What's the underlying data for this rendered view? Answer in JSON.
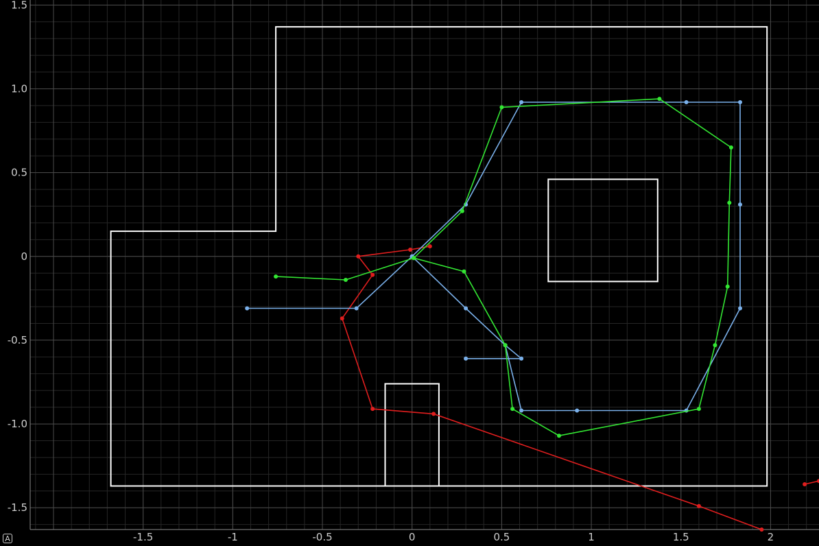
{
  "chart_data": {
    "type": "line",
    "title": "",
    "xlabel": "",
    "ylabel": "",
    "xlim": [
      -2.13,
      2.27
    ],
    "ylim": [
      -1.63,
      1.53
    ],
    "grid": true,
    "x_ticks": [
      -1.5,
      -1,
      -0.5,
      0,
      0.5,
      1,
      1.5,
      2
    ],
    "x_tick_labels": [
      "-1.5",
      "-1",
      "-0.5",
      "0",
      "0.5",
      "1",
      "1.5",
      "2"
    ],
    "y_ticks": [
      1.5,
      1.0,
      0.5,
      0,
      -0.5,
      -1.0,
      -1.5
    ],
    "y_tick_labels": [
      "1.5",
      "1.0",
      "0.5",
      "0",
      "-0.5",
      "-1.0",
      "-1.5"
    ],
    "obstacles": [
      {
        "name": "",
        "points": [
          [
            -0.76,
            1.37
          ],
          [
            1.98,
            1.37
          ],
          [
            1.98,
            -1.37
          ],
          [
            -1.68,
            -1.37
          ],
          [
            -1.68,
            0.15
          ],
          [
            -0.76,
            0.15
          ]
        ]
      },
      {
        "name": "",
        "points": [
          [
            0.76,
            0.46
          ],
          [
            1.37,
            0.46
          ],
          [
            1.37,
            -0.15
          ],
          [
            0.76,
            -0.15
          ]
        ]
      },
      {
        "name": "",
        "points": [
          [
            -0.15,
            -1.37
          ],
          [
            -0.15,
            -0.76
          ],
          [
            0.15,
            -0.76
          ],
          [
            0.15,
            -1.37
          ]
        ]
      }
    ],
    "series": [
      {
        "name": "",
        "color": "#e01e1e",
        "points": [
          [
            0.1,
            0.06
          ],
          [
            -0.01,
            0.04
          ],
          [
            -0.3,
            0.0
          ],
          [
            -0.22,
            -0.11
          ],
          [
            -0.39,
            -0.37
          ],
          [
            -0.22,
            -0.91
          ],
          [
            0.12,
            -0.94
          ],
          [
            1.6,
            -1.49
          ],
          [
            1.95,
            -1.63
          ]
        ]
      },
      {
        "name": "",
        "color": "#e01e1e",
        "points": [
          [
            2.19,
            -1.36
          ],
          [
            2.27,
            -1.34
          ]
        ]
      },
      {
        "name": "",
        "color": "#7ab0ea",
        "points": [
          [
            -0.92,
            -0.31
          ],
          [
            -0.31,
            -0.31
          ],
          [
            0.0,
            0.0
          ],
          [
            0.3,
            0.31
          ],
          [
            0.61,
            0.92
          ],
          [
            1.53,
            0.92
          ],
          [
            1.83,
            0.92
          ],
          [
            1.83,
            0.31
          ],
          [
            1.83,
            -0.31
          ],
          [
            1.53,
            -0.92
          ],
          [
            0.92,
            -0.92
          ],
          [
            0.61,
            -0.92
          ],
          [
            0.52,
            -0.53
          ],
          [
            0.3,
            -0.31
          ],
          [
            0.0,
            0.0
          ]
        ]
      },
      {
        "name": "",
        "color": "#7ab0ea",
        "points": [
          [
            0.3,
            -0.61
          ],
          [
            0.61,
            -0.61
          ],
          [
            0.52,
            -0.53
          ]
        ]
      },
      {
        "name": "",
        "color": "#33e633",
        "points": [
          [
            -0.76,
            -0.12
          ],
          [
            -0.37,
            -0.14
          ],
          [
            0.01,
            -0.01
          ],
          [
            0.28,
            0.27
          ],
          [
            0.5,
            0.89
          ],
          [
            1.38,
            0.94
          ],
          [
            1.78,
            0.65
          ],
          [
            1.77,
            0.32
          ],
          [
            1.76,
            -0.18
          ],
          [
            1.69,
            -0.53
          ],
          [
            1.6,
            -0.91
          ],
          [
            0.82,
            -1.07
          ],
          [
            0.56,
            -0.91
          ],
          [
            0.52,
            -0.53
          ],
          [
            0.29,
            -0.09
          ],
          [
            0.01,
            -0.01
          ]
        ]
      }
    ]
  }
}
